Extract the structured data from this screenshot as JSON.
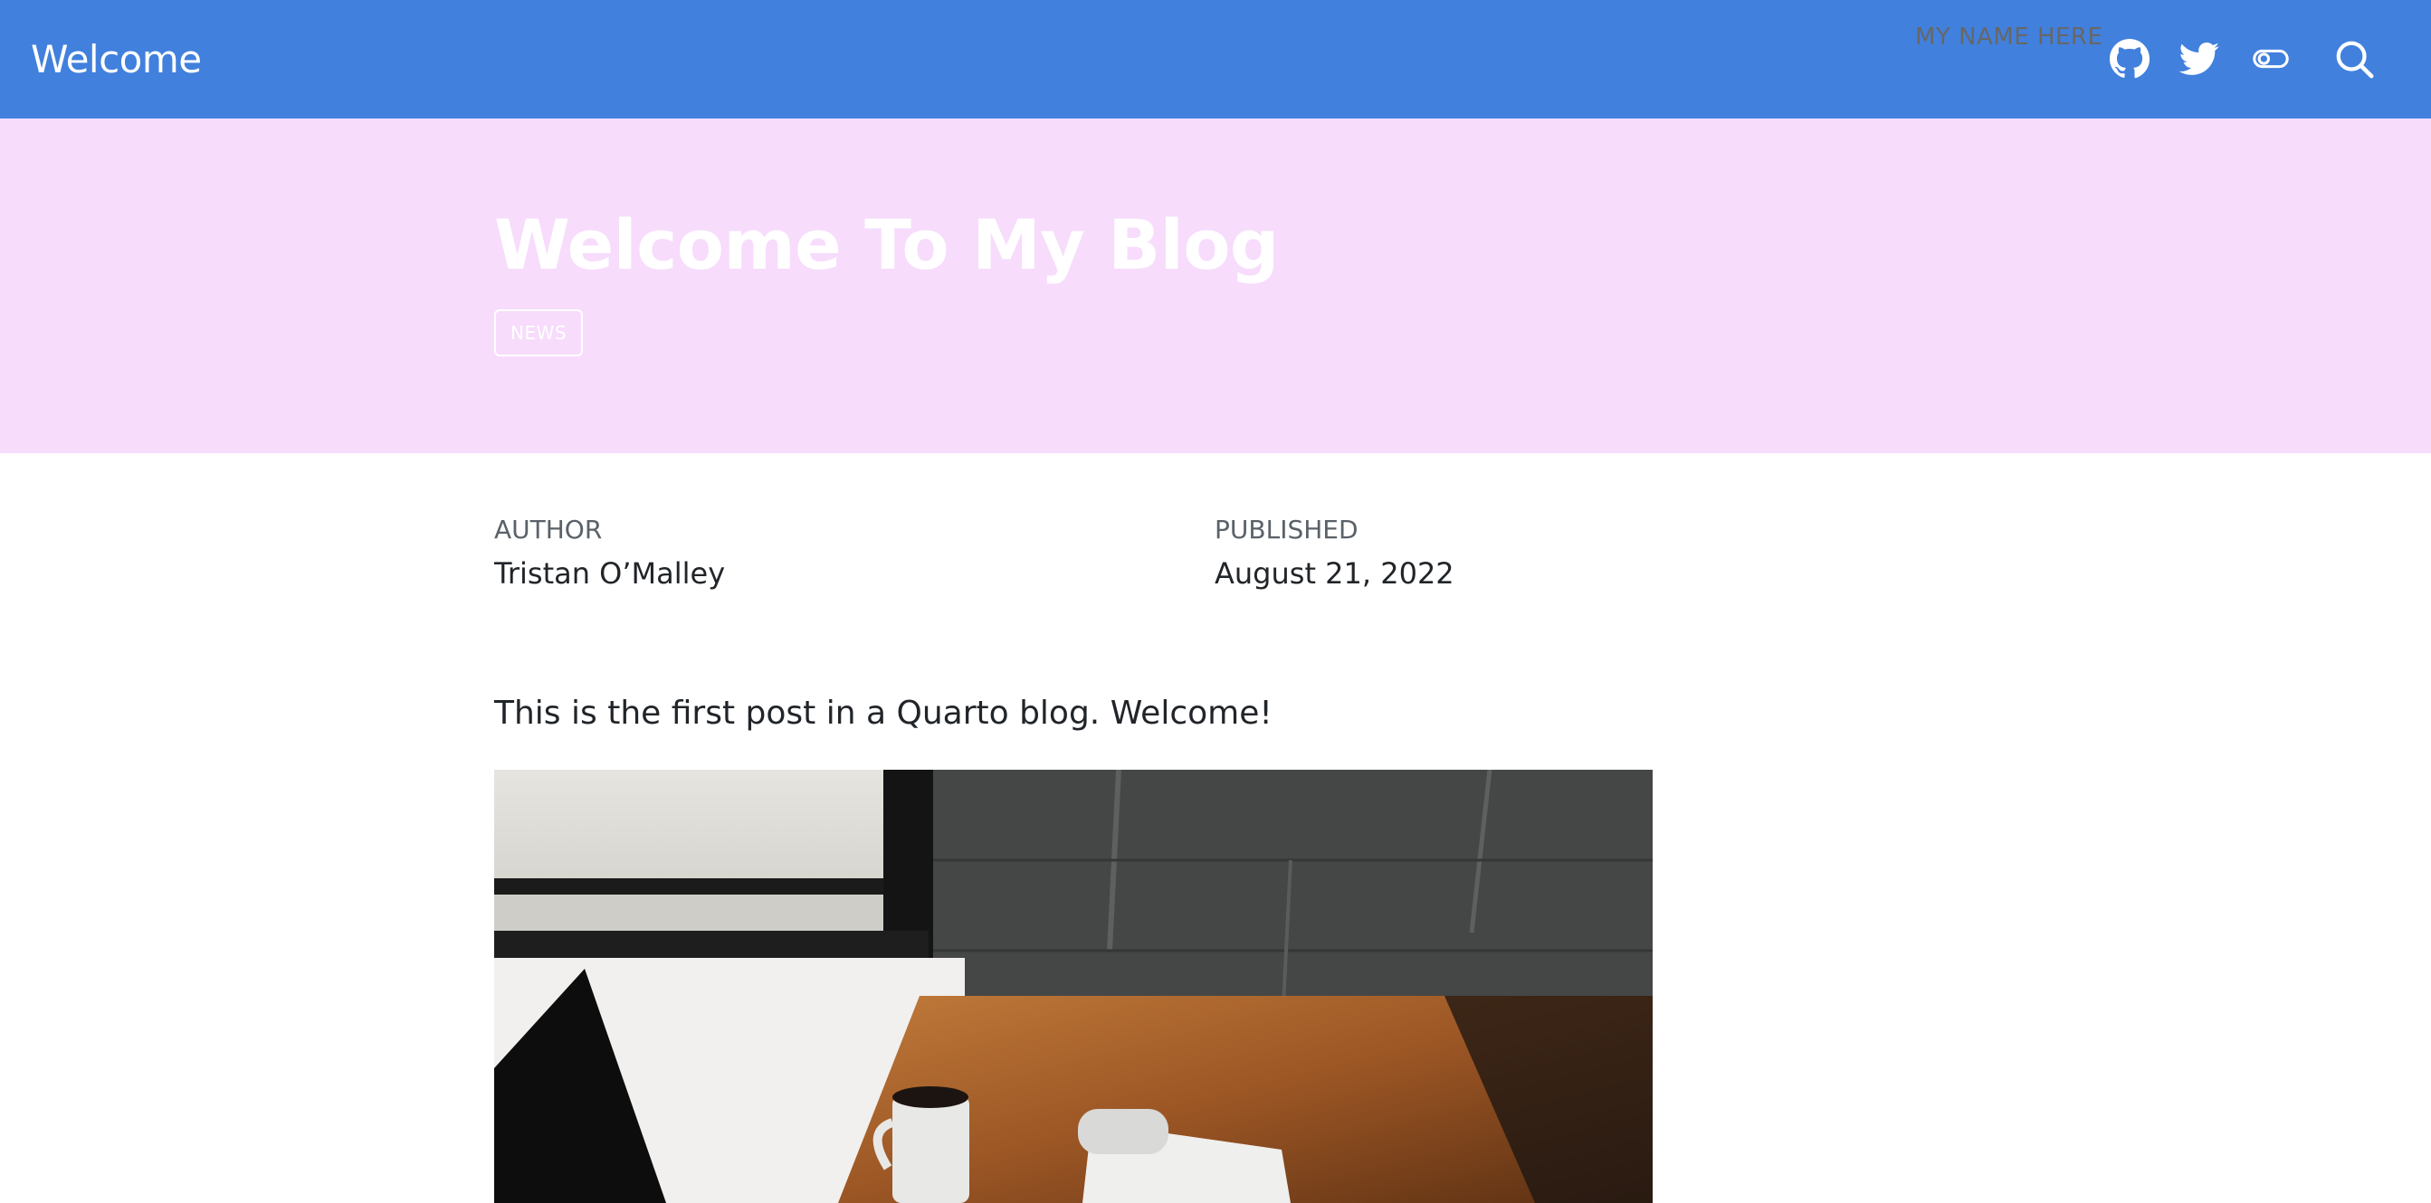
{
  "navbar": {
    "brand": "Welcome",
    "name_link": "MY NAME HERE",
    "icons": {
      "github": "github-icon",
      "twitter": "twitter-icon",
      "toggle": "toggle-icon",
      "search": "search-icon"
    },
    "background": "#4180dd"
  },
  "banner": {
    "title": "Welcome To My Blog",
    "category": "NEWS",
    "background": "#f7dcfc"
  },
  "meta": {
    "author_label": "AUTHOR",
    "author": "Tristan O’Malley",
    "published_label": "PUBLISHED",
    "published": "August 21, 2022"
  },
  "content": {
    "intro": "This is the first post in a Quarto blog. Welcome!"
  }
}
